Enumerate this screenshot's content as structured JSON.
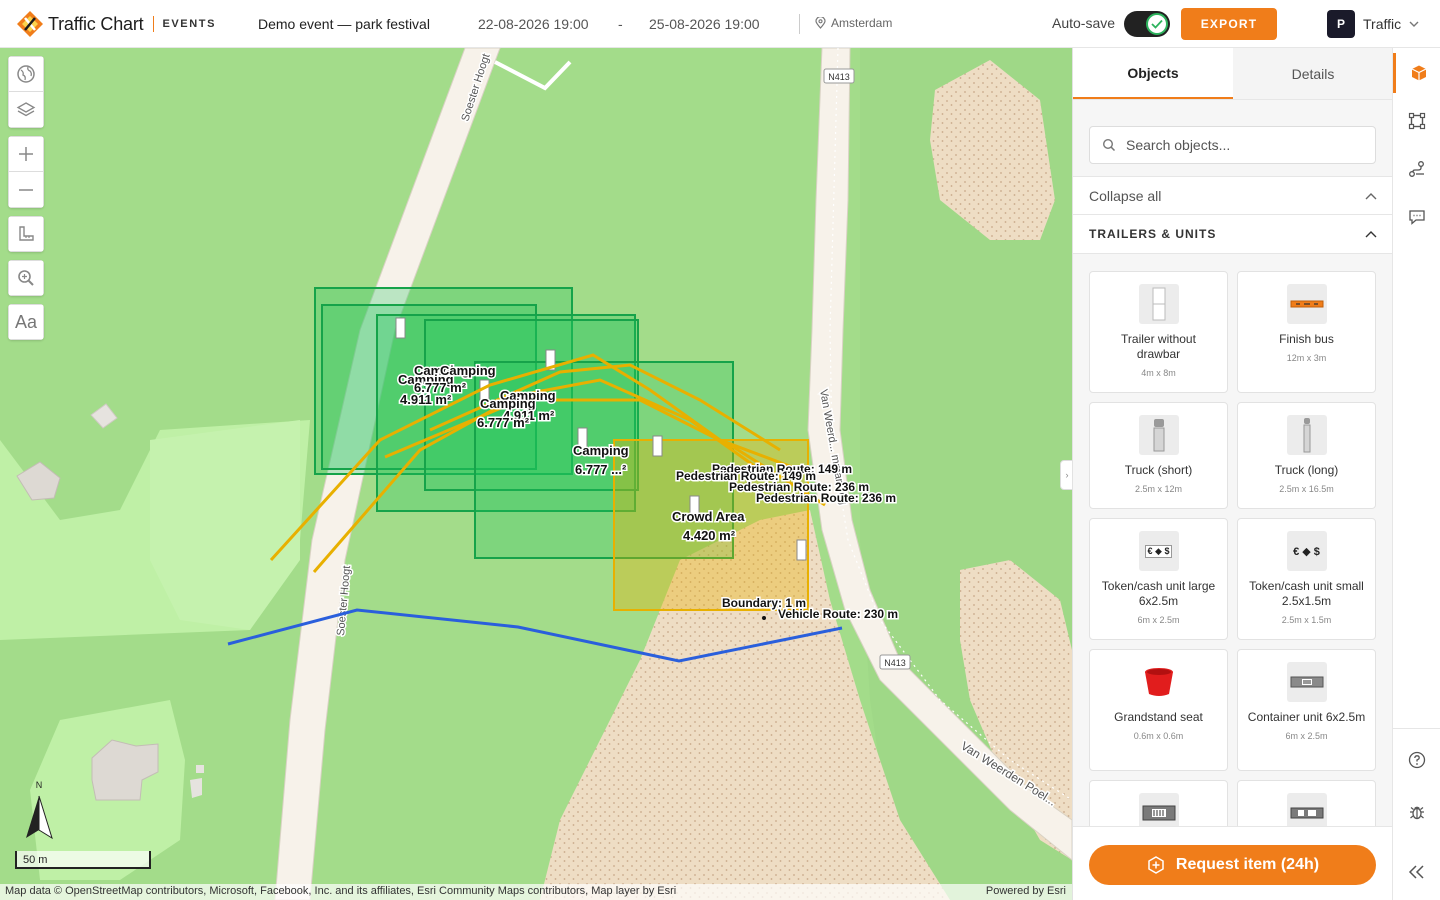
{
  "app": {
    "name": "Traffic Chart",
    "section": "EVENTS",
    "colors": {
      "accent": "#f07d1a",
      "success": "#2db35d",
      "route_pedestrian": "#e8b000",
      "route_vehicle": "#2a5fdc",
      "object_fill": "#22c55e",
      "crowd_area": "#e8b000"
    }
  },
  "header": {
    "event_title": "Demo event — park festival",
    "date_start": "22-08-2026 19:00",
    "date_separator": "-",
    "date_end": "25-08-2026 19:00",
    "location": "Amsterdam",
    "autosave_label": "Auto-save",
    "autosave_on": true,
    "export_label": "EXPORT",
    "user_initial": "P",
    "user_name": "Traffic"
  },
  "map": {
    "tools": [
      "globe-icon",
      "layers-icon",
      "zoom-in-icon",
      "zoom-out-icon",
      "measure-icon",
      "zoom-search-icon",
      "text-icon"
    ],
    "text_tool_label": "Aa",
    "north_label": "N",
    "scale_label": "50 m",
    "attribution": "Map data © OpenStreetMap contributors, Microsoft, Facebook, Inc. and its affiliates, Esri Community Maps contributors, Map layer by Esri",
    "powered_by": "Powered by Esri",
    "road_labels": {
      "soester_hoogt_top": "Soester Hoogt",
      "soester_hoogt_bottom": "Soester Hoogt",
      "van_weerd_vertical": "Van Weerd... mmanweg",
      "van_weerden_poel": "Van Weerden Poel...",
      "shield_top": "N413",
      "shield_bottom": "N413"
    },
    "object_labels": {
      "camping_a": "Camping",
      "camping_a_area": "4.911 m²",
      "camping_b": "Camping",
      "camping_b_area": "6.777 m²",
      "camping_c": "Camping",
      "camping_c_area": "4.911 m²",
      "camping_d": "Camping",
      "camping_d_area": "6.777 m²",
      "camping_e": "Camping",
      "camping_e_area": "6.777 ...²",
      "crowd_area": "Crowd Area",
      "crowd_area_size": "4.420 m²",
      "ped_route_1": "Pedestrian Route: 149 m",
      "ped_route_2": "Pedestrian Route: 149 m",
      "ped_route_3": "Pedestrian Route: 236 m",
      "ped_route_4": "Pedestrian Route: 236 m",
      "boundary": "Boundary: 1 m",
      "vehicle_route": "Vehicle Route: 230 m"
    }
  },
  "panel": {
    "tabs": [
      {
        "label": "Objects",
        "active": true
      },
      {
        "label": "Details",
        "active": false
      }
    ],
    "search_placeholder": "Search objects...",
    "collapse_label": "Collapse all",
    "section_title": "TRAILERS & UNITS",
    "items": [
      {
        "name": "Trailer without drawbar",
        "dims": "4m x 8m",
        "icon": "trailer-icon"
      },
      {
        "name": "Finish bus",
        "dims": "12m x 3m",
        "icon": "finish-bus-icon"
      },
      {
        "name": "Truck (short)",
        "dims": "2.5m x 12m",
        "icon": "truck-short-icon"
      },
      {
        "name": "Truck (long)",
        "dims": "2.5m x 16.5m",
        "icon": "truck-long-icon"
      },
      {
        "name": "Token/cash unit large 6x2.5m",
        "dims": "6m x 2.5m",
        "icon": "cash-unit-large-icon",
        "glyph": "€ ◆ $"
      },
      {
        "name": "Token/cash unit small 2.5x1.5m",
        "dims": "2.5m x 1.5m",
        "icon": "cash-unit-small-icon",
        "glyph": "€ ◆ $"
      },
      {
        "name": "Grandstand seat",
        "dims": "0.6m x 0.6m",
        "icon": "grandstand-seat-icon"
      },
      {
        "name": "Container unit 6x2.5m",
        "dims": "6m x 2.5m",
        "icon": "container-unit-icon"
      },
      {
        "name": "",
        "dims": "",
        "icon": "container-unit-2-icon"
      },
      {
        "name": "",
        "dims": "",
        "icon": "container-unit-3-icon"
      }
    ],
    "request_label": "Request item (24h)"
  },
  "rail": [
    "objects-icon",
    "draw-area-icon",
    "route-icon",
    "comment-icon",
    "help-icon",
    "bug-icon",
    "collapse-panel-icon"
  ]
}
